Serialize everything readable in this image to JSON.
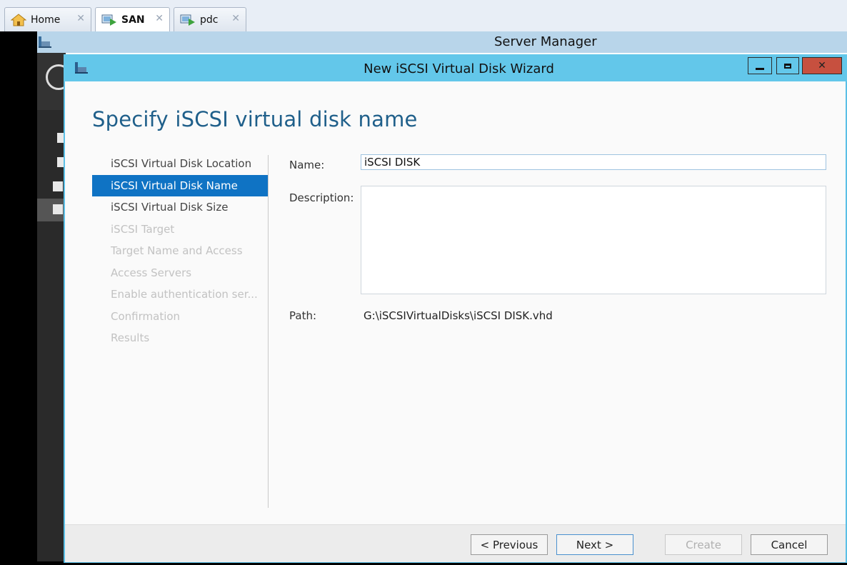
{
  "vm_tabs": [
    {
      "label": "Home",
      "icon": "home-icon",
      "active": false
    },
    {
      "label": "SAN",
      "icon": "vm-running-icon",
      "active": true
    },
    {
      "label": "pdc",
      "icon": "vm-running-icon",
      "active": false
    }
  ],
  "server_manager": {
    "title": "Server Manager"
  },
  "wizard": {
    "title": "New iSCSI Virtual Disk Wizard",
    "heading": "Specify iSCSI virtual disk name",
    "steps": [
      {
        "label": "iSCSI Virtual Disk Location",
        "state": "done"
      },
      {
        "label": "iSCSI Virtual Disk Name",
        "state": "active"
      },
      {
        "label": "iSCSI Virtual Disk Size",
        "state": "enabled"
      },
      {
        "label": "iSCSI Target",
        "state": "disabled"
      },
      {
        "label": "Target Name and Access",
        "state": "disabled"
      },
      {
        "label": "Access Servers",
        "state": "disabled"
      },
      {
        "label": "Enable authentication ser...",
        "state": "disabled"
      },
      {
        "label": "Confirmation",
        "state": "disabled"
      },
      {
        "label": "Results",
        "state": "disabled"
      }
    ],
    "form": {
      "name_label": "Name:",
      "name_value": "iSCSI DISK",
      "description_label": "Description:",
      "description_value": "",
      "path_label": "Path:",
      "path_value": "G:\\iSCSIVirtualDisks\\iSCSI DISK.vhd"
    },
    "buttons": {
      "previous": "< Previous",
      "next": "Next >",
      "create": "Create",
      "cancel": "Cancel"
    }
  },
  "colors": {
    "wizard_frame": "#5bbfe6",
    "heading": "#1f5f8a",
    "active_step": "#0f73c4",
    "close_button": "#c7503f"
  }
}
